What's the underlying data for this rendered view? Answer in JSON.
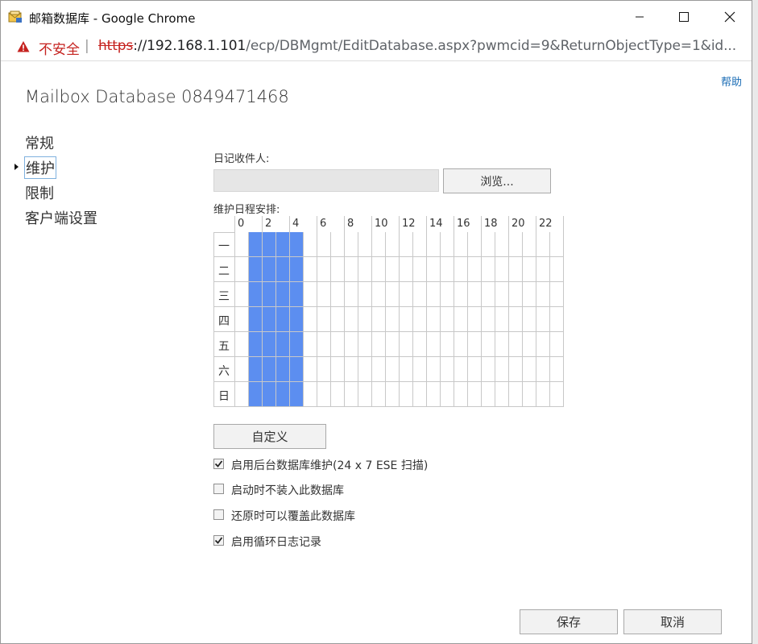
{
  "window": {
    "title": "邮箱数据库 - Google Chrome",
    "minimize_icon": "minimize-icon",
    "maximize_icon": "maximize-icon",
    "close_icon": "close-icon"
  },
  "address": {
    "security_label": "不安全",
    "scheme": "https",
    "host": "://192.168.1.101",
    "path": "/ecp/DBMgmt/EditDatabase.aspx?pwmcid=9&ReturnObjectType=1&id..."
  },
  "help_link": "帮助",
  "page_title": "Mailbox Database 0849471468",
  "nav": {
    "items": [
      {
        "label": "常规",
        "selected": false
      },
      {
        "label": "维护",
        "selected": true
      },
      {
        "label": "限制",
        "selected": false
      },
      {
        "label": "客户端设置",
        "selected": false
      }
    ]
  },
  "journal": {
    "label": "日记收件人:",
    "value": "",
    "browse_button": "浏览..."
  },
  "schedule": {
    "label": "维护日程安排:",
    "hour_labels": [
      "0",
      "2",
      "4",
      "6",
      "8",
      "10",
      "12",
      "14",
      "16",
      "18",
      "20",
      "22"
    ],
    "days": [
      "一",
      "二",
      "三",
      "四",
      "五",
      "六",
      "日"
    ],
    "selected_half_hour_slots": [
      1,
      2,
      3,
      4
    ],
    "selected_color": "#5c8ef0",
    "customize_button": "自定义"
  },
  "options": [
    {
      "label": "启用后台数据库维护(24 x 7 ESE 扫描)",
      "checked": true
    },
    {
      "label": "启动时不装入此数据库",
      "checked": false
    },
    {
      "label": "还原时可以覆盖此数据库",
      "checked": false
    },
    {
      "label": "启用循环日志记录",
      "checked": true
    }
  ],
  "footer": {
    "save_button": "保存",
    "cancel_button": "取消"
  }
}
